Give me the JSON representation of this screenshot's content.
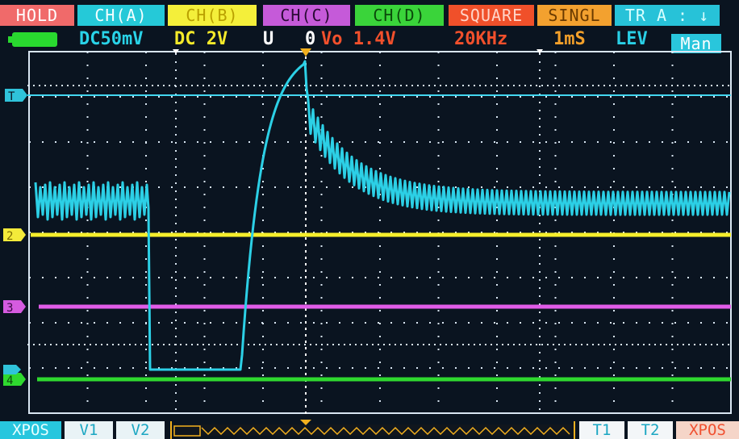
{
  "top_menu": [
    {
      "label": "HOLD",
      "bg": "#f06a6a",
      "fg": "#ffffff"
    },
    {
      "label": "CH(A)",
      "bg": "#25c9d8",
      "fg": "#f5ffff"
    },
    {
      "label": "CH(B)",
      "bg": "#f4ef3a",
      "fg": "#b9a000"
    },
    {
      "label": "CH(C)",
      "bg": "#c55ad9",
      "fg": "#2a0a35"
    },
    {
      "label": "CH(D)",
      "bg": "#3ad43a",
      "fg": "#0b4a0b"
    },
    {
      "label": "SQUARE",
      "bg": "#f0502a",
      "fg": "#ffd5c9"
    },
    {
      "label": "SINGL",
      "bg": "#f3a12f",
      "fg": "#6a3a00"
    },
    {
      "label": "TR A : ↓",
      "bg": "#27c2d8",
      "fg": "#d8ffff"
    }
  ],
  "status": {
    "coupling_a": "DC50mV",
    "coupling_b": "DC 2V",
    "mode": "U",
    "vo_num": "0",
    "vo_label": "Vo 1.4V",
    "frequency": "20KHz",
    "timebase": "1mS",
    "lev": "LEV",
    "man": "Man"
  },
  "markers": {
    "t": "T",
    "ch2": "2",
    "ch3": "3",
    "ch4": "4"
  },
  "bottom_menu": {
    "xpos_left": "XPOS",
    "v1": "V1",
    "v2": "V2",
    "t1": "T1",
    "t2": "T2",
    "xpos_right": "XPOS"
  },
  "colors": {
    "ch_a": "#2cd0e6",
    "ch_b": "#f6ef2c",
    "ch_c": "#e15ce8",
    "ch_d": "#2fd92f",
    "grid": "#d9e6f2",
    "trigger_line": "#43d6ef",
    "bottom_accent": "#f2b01f"
  },
  "chart_data": {
    "type": "line",
    "series": [
      {
        "name": "CH(A)",
        "color": "#2cd0e6"
      },
      {
        "name": "CH(B)",
        "color": "#f6ef2c"
      },
      {
        "name": "CH(C)",
        "color": "#e15ce8"
      },
      {
        "name": "CH(D)",
        "color": "#2fd92f"
      }
    ],
    "x_divisions": 12,
    "y_divisions": 8,
    "grid": true
  }
}
